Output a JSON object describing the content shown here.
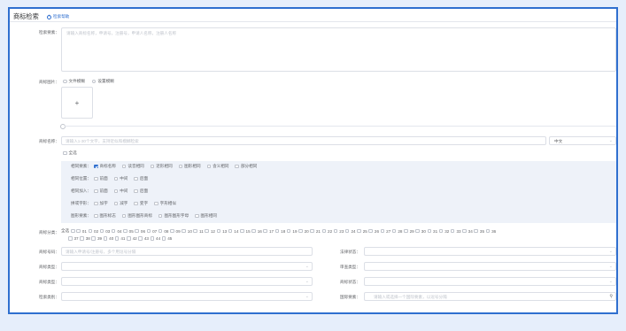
{
  "header": {
    "title": "商标检索",
    "help": "检索帮助"
  },
  "fields": {
    "keyword_label": "检索要素：",
    "keyword_placeholder": "请输入商标名称，申请号，注册号，申请人名称，注册人名称",
    "image_label": "商标图片：",
    "image_options": [
      "文件模糊",
      "设置模糊"
    ],
    "upload_plus": "+",
    "name_label": "商标名称：",
    "name_placeholder": "请输入1-30个文字，支持近似和模糊检索",
    "lang_value": "中文",
    "select_all": "全选"
  },
  "filters": [
    {
      "label": "相同要素：",
      "options": [
        {
          "text": "商标名称",
          "checked": true
        },
        {
          "text": "读音相同",
          "checked": false
        },
        {
          "text": "近形相同",
          "checked": false
        },
        {
          "text": "图形相同",
          "checked": false
        },
        {
          "text": "含义相同",
          "checked": false
        },
        {
          "text": "部分相同",
          "checked": false
        }
      ]
    },
    {
      "label": "相同位置：",
      "options": [
        {
          "text": "前面",
          "checked": false
        },
        {
          "text": "中间",
          "checked": false
        },
        {
          "text": "后面",
          "checked": false
        }
      ]
    },
    {
      "label": "相同加入：",
      "options": [
        {
          "text": "前面",
          "checked": false
        },
        {
          "text": "中间",
          "checked": false
        },
        {
          "text": "后面",
          "checked": false
        }
      ]
    },
    {
      "label": "拼或字形：",
      "options": [
        {
          "text": "加字",
          "checked": false
        },
        {
          "text": "减字",
          "checked": false
        },
        {
          "text": "变字",
          "checked": false
        },
        {
          "text": "字形相似",
          "checked": false
        }
      ]
    },
    {
      "label": "图形要素：",
      "options": [
        {
          "text": "图形标志",
          "checked": false
        },
        {
          "text": "图形图形商标",
          "checked": false
        },
        {
          "text": "图形图形字母",
          "checked": false
        },
        {
          "text": "图形相同",
          "checked": false
        }
      ]
    }
  ],
  "classes": {
    "label": "商标分类：",
    "all_label": "全选",
    "row1": [
      "01",
      "02",
      "03",
      "04",
      "05",
      "06",
      "07",
      "08",
      "09",
      "10",
      "11",
      "12",
      "13",
      "14",
      "15",
      "16",
      "17",
      "18",
      "19",
      "20",
      "21",
      "22",
      "23",
      "24",
      "25",
      "26",
      "27",
      "28",
      "29",
      "30",
      "31",
      "32",
      "33",
      "34",
      "35",
      "36"
    ],
    "row2": [
      "37",
      "38",
      "39",
      "40",
      "41",
      "42",
      "43",
      "44",
      "45"
    ]
  },
  "bottom": {
    "reg_label": "商标号码：",
    "reg_placeholder": "请输入申请号/注册号，多个用逗号分隔",
    "status_label": "法律状态：",
    "r2_left_label": "商标类型：",
    "r2_right_label": "审查类型：",
    "r3_left_label": "商标类型：",
    "r3_right_label": "商标状态：",
    "r4_left_label": "检索类别：",
    "r4_right_label": "国际要素：",
    "r4_right_placeholder": "请输入或选择一个国际要素，以逗号分隔"
  },
  "colors": {
    "accent": "#2f6fcf",
    "frame": "#2f6fcf",
    "background": "#e6eefb",
    "panel": "#eef2f9"
  }
}
